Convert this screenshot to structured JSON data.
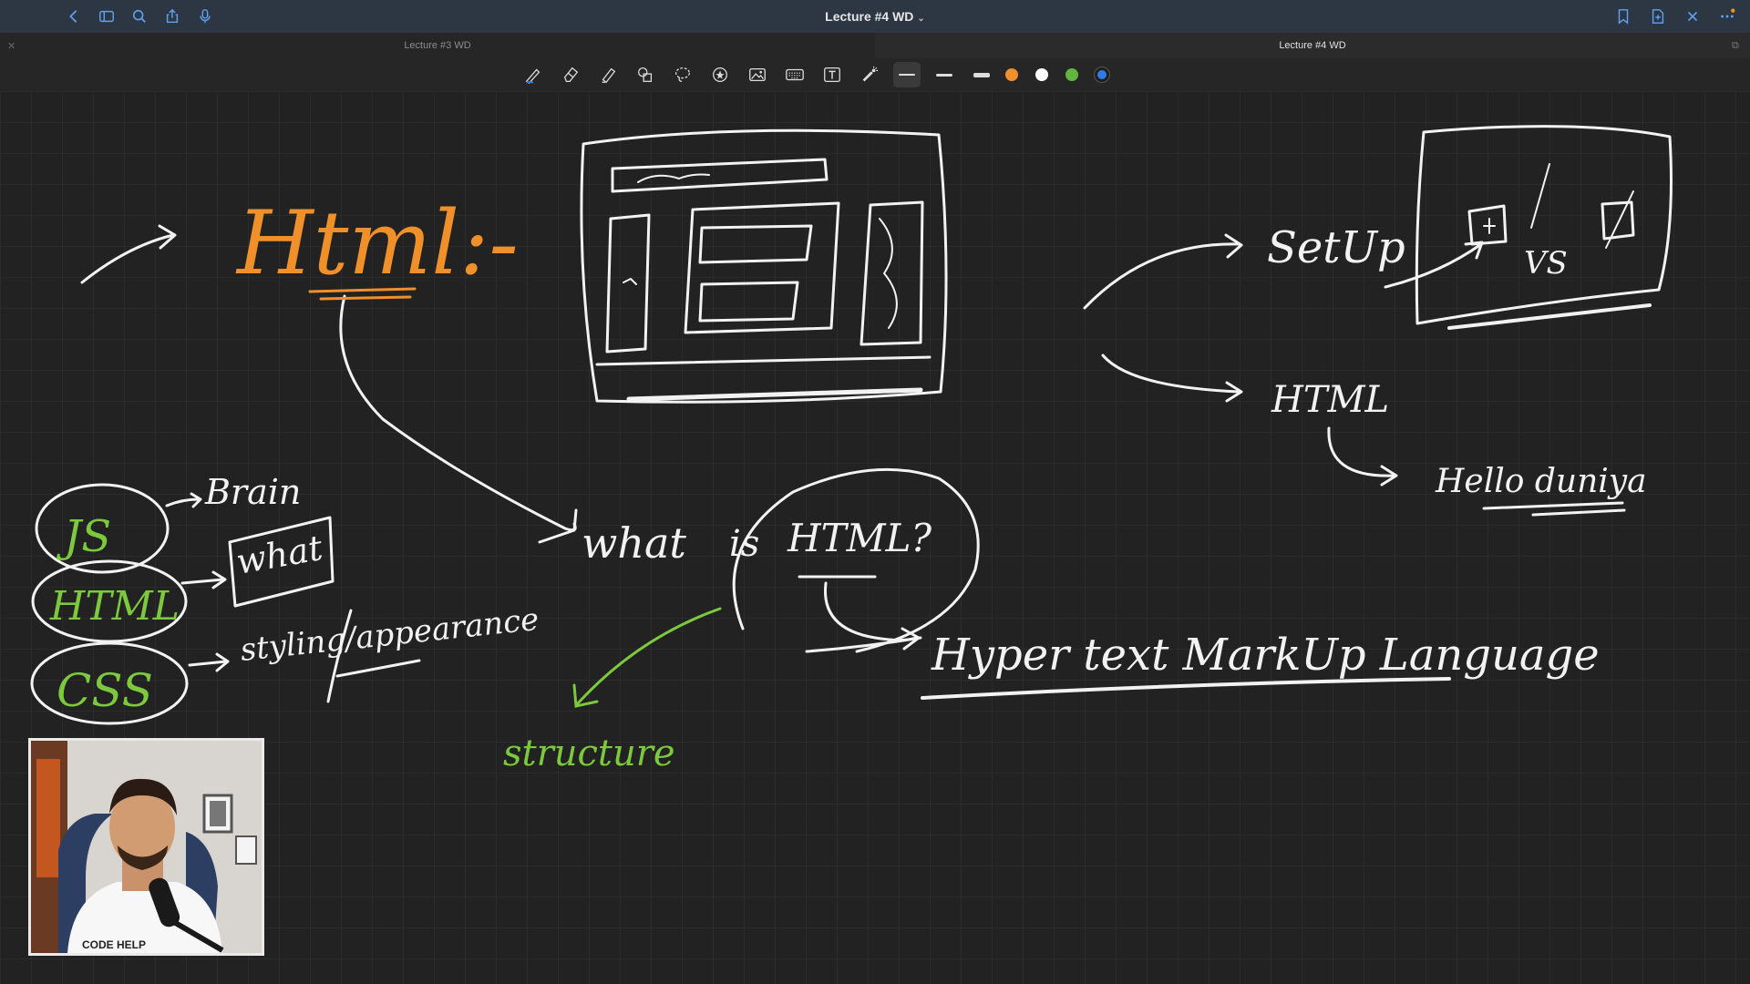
{
  "window": {
    "title": "Lecture #4 WD",
    "title_chevron": "⌄"
  },
  "tabs": [
    {
      "label": "Lecture #3 WD",
      "active": false
    },
    {
      "label": "Lecture #4 WD",
      "active": true
    }
  ],
  "toolbar": {
    "tools": [
      "pen-icon",
      "eraser-icon",
      "highlighter-icon",
      "shapes-icon",
      "lasso-icon",
      "sticker-icon",
      "image-icon",
      "keyboard-icon",
      "text-icon",
      "laser-pointer-icon"
    ],
    "colors": [
      "#f0902a",
      "#ffffff",
      "#5fb83d",
      "#2f7be8"
    ],
    "accent": "#2f7be8"
  },
  "notes": {
    "html_heading": "Html:-",
    "setup_label": "SetUp",
    "vs_label": "VS",
    "html_label": "HTML",
    "hello_label": "Hello duniya",
    "js_label": "JS",
    "brain_label": "Brain",
    "html_oval_label": "HTML",
    "what_box_label": "what",
    "css_label": "CSS",
    "styling_label": "styling/appearance",
    "question_what": "what",
    "question_is": "is",
    "question_html": "HTML?",
    "expansion": "Hyper text MarkUp Language",
    "structure_label": "structure",
    "colors": {
      "orange": "#f0902a",
      "white": "#f2f2f2",
      "green": "#7cc93e"
    }
  },
  "webcam": {
    "shirt_text": "CODE HELP"
  }
}
